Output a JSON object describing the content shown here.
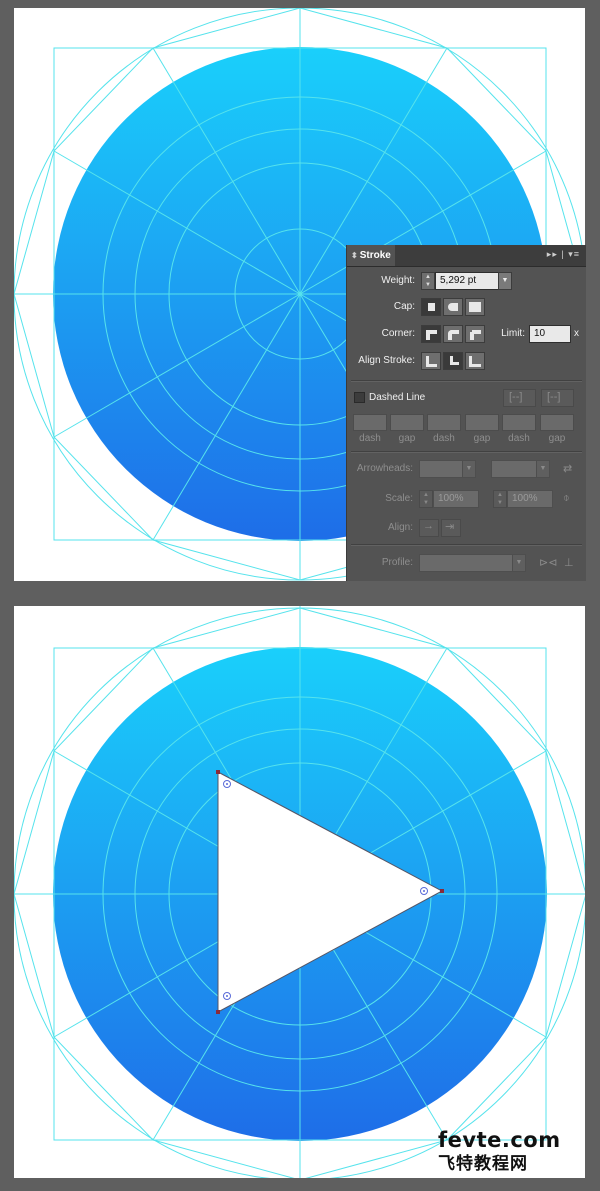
{
  "stroke_panel": {
    "tab_title": "Stroke",
    "weight_label": "Weight:",
    "weight_value": "5,292 pt",
    "cap_label": "Cap:",
    "corner_label": "Corner:",
    "limit_label": "Limit:",
    "limit_value": "10",
    "limit_unit": "x",
    "align_stroke_label": "Align Stroke:",
    "dashed_line_label": "Dashed Line",
    "dashed_line_checked": false,
    "dash_gap_labels": [
      "dash",
      "gap",
      "dash",
      "gap",
      "dash",
      "gap"
    ],
    "arrowheads_label": "Arrowheads:",
    "scale_label": "Scale:",
    "scale_start_value": "100%",
    "scale_end_value": "100%",
    "align_label": "Align:",
    "profile_label": "Profile:",
    "selected_cap": "butt",
    "selected_corner": "miter",
    "selected_align": "center"
  },
  "artwork": {
    "gradient_top_color": "#1ad0fb",
    "gradient_bottom_color": "#1e6de8",
    "guide_color": "#56e3ec",
    "shape": "play-triangle"
  },
  "watermark": {
    "brand": "fevte.com",
    "subtitle": "飞特教程网"
  }
}
